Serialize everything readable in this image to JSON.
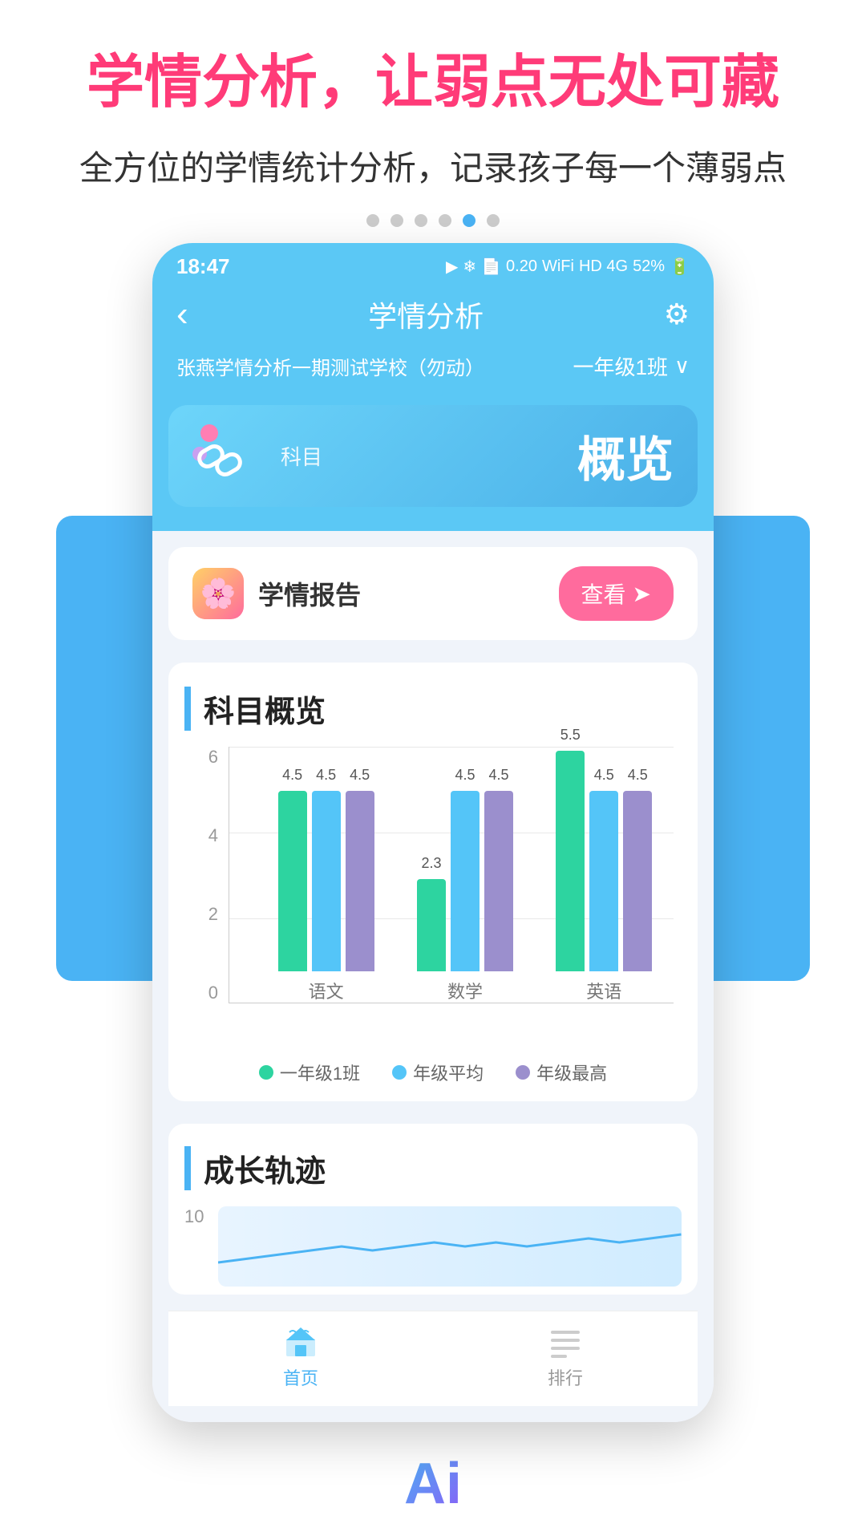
{
  "page": {
    "main_title": "学情分析，让弱点无处可藏",
    "sub_title": "全方位的学情统计分析，记录孩子每一个薄弱点"
  },
  "status_bar": {
    "time": "18:47",
    "right_info": "0.20 K/s  HD  4G  52%"
  },
  "nav": {
    "back_icon": "‹",
    "title": "学情分析",
    "gear_icon": "⚙"
  },
  "school": {
    "name": "张燕学情分析一期测试学校（勿动）",
    "class": "一年级1班",
    "dropdown_icon": "∨"
  },
  "subject_tab": {
    "icon_label": "科目",
    "name": "概览"
  },
  "report": {
    "icon": "🌸",
    "label": "学情报告",
    "view_btn": "查看",
    "view_icon": "⊙"
  },
  "chart_section": {
    "title": "科目概览",
    "y_labels": [
      "6",
      "4",
      "2",
      "0"
    ],
    "groups": [
      {
        "subject": "语文",
        "bars": [
          {
            "value": 4.5,
            "label": "4.5",
            "color": "green"
          },
          {
            "value": 4.5,
            "label": "4.5",
            "color": "blue"
          },
          {
            "value": 4.5,
            "label": "4.5",
            "color": "purple"
          }
        ]
      },
      {
        "subject": "数学",
        "bars": [
          {
            "value": 2.3,
            "label": "2.3",
            "color": "green"
          },
          {
            "value": 4.5,
            "label": "4.5",
            "color": "blue"
          },
          {
            "value": 4.5,
            "label": "4.5",
            "color": "purple"
          }
        ]
      },
      {
        "subject": "英语",
        "bars": [
          {
            "value": 5.5,
            "label": "5.5",
            "color": "green"
          },
          {
            "value": 4.5,
            "label": "4.5",
            "color": "blue"
          },
          {
            "value": 4.5,
            "label": "4.5",
            "color": "purple"
          }
        ]
      }
    ],
    "legend": [
      {
        "label": "一年级1班",
        "color": "#2dd4a0"
      },
      {
        "label": "年级平均",
        "color": "#54c5f8"
      },
      {
        "label": "年级最高",
        "color": "#9b8fcd"
      }
    ],
    "max_value": 6
  },
  "growth_section": {
    "title": "成长轨迹",
    "y_max": "10"
  },
  "bottom_nav": {
    "items": [
      {
        "label": "首页",
        "active": true,
        "icon": "home"
      },
      {
        "label": "排行",
        "active": false,
        "icon": "rank"
      }
    ]
  },
  "ai_badge": "Ai"
}
